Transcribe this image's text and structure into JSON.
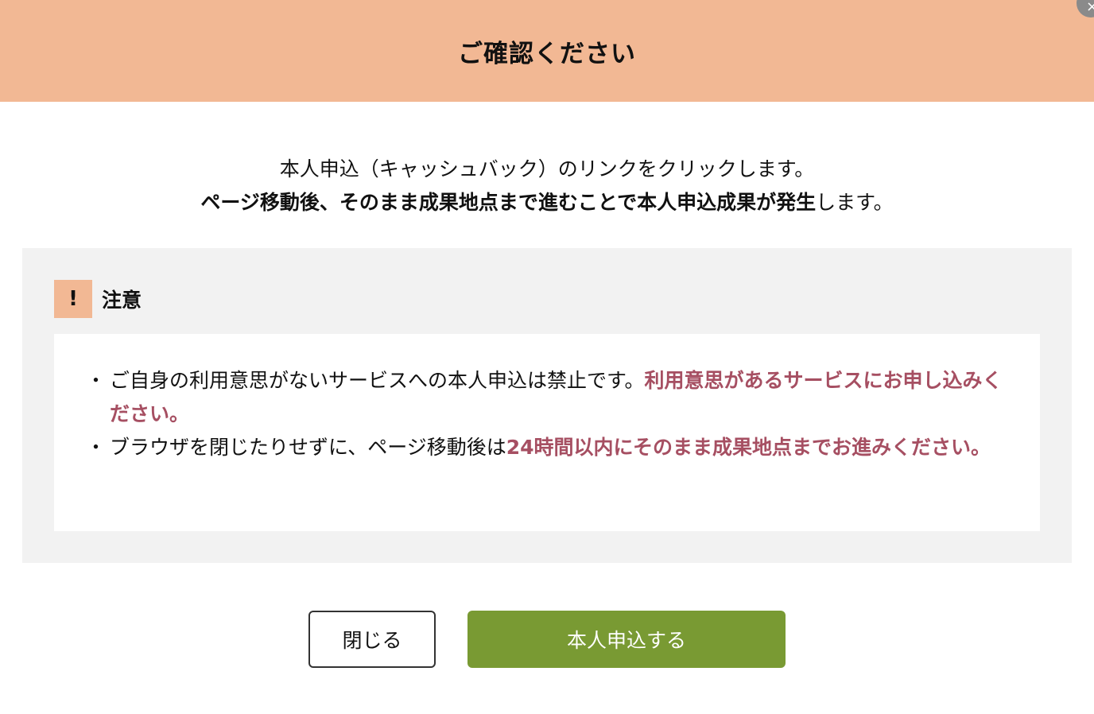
{
  "header": {
    "title": "ご確認ください",
    "close_icon": "×"
  },
  "intro": {
    "line1": "本人申込（キャッシュバック）のリンクをクリックします。",
    "line2_strong": "ページ移動後、そのまま成果地点まで進むことで本人申込成果が発生",
    "line2_tail": "します。"
  },
  "caution": {
    "mark": "!",
    "label": "注意",
    "items": [
      {
        "bullet": "・",
        "text": "ご自身の利用意思がないサービスへの本人申込は禁止です。",
        "emphasis": "利用意思があるサービスにお申し込みください。"
      },
      {
        "bullet": "・",
        "text": "ブラウザを閉じたりせずに、ページ移動後は",
        "emphasis": "24時間以内にそのまま成果地点までお進みください。"
      }
    ]
  },
  "buttons": {
    "close_label": "閉じる",
    "apply_label": "本人申込する"
  },
  "colors": {
    "header_bg": "#f2b894",
    "emphasis": "#a64f62",
    "apply_button": "#799a33",
    "caution_bg": "#f2f2f2"
  }
}
